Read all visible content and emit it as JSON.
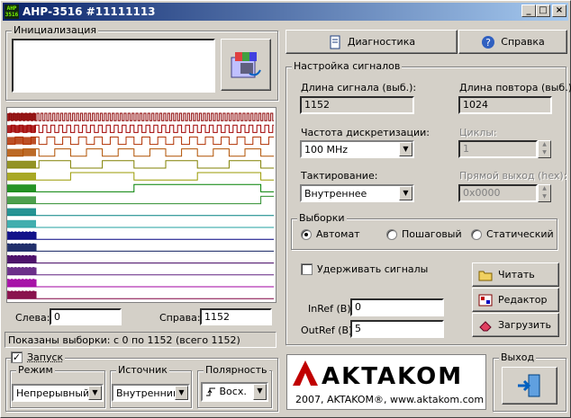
{
  "window": {
    "title": "АНР-3516 #11111113",
    "icon_text": "АНР 3516",
    "minimize": "_",
    "maximize": "□",
    "close": "×"
  },
  "init": {
    "group_label": "Инициализация",
    "text": ""
  },
  "toolbar": {
    "diagnostics_label": "Диагностика",
    "help_label": "Справка"
  },
  "signals": {
    "group_label": "Настройка сигналов",
    "length_label": "Длина сигнала (выб.):",
    "length_value": "1152",
    "repeat_label": "Длина повтора (выб.):",
    "repeat_value": "1024",
    "rate_label": "Частота дискретизации:",
    "rate_value": "100 MHz",
    "cycles_label": "Циклы:",
    "cycles_value": "1",
    "clock_label": "Тактирование:",
    "clock_value": "Внутреннее",
    "direct_label": "Прямой выход (hex):",
    "direct_value": "0x0000"
  },
  "samples": {
    "group_label": "Выборки",
    "auto": "Автомат",
    "step": "Пошаговый",
    "static": "Статический",
    "selected": "auto"
  },
  "hold": {
    "label": "Удерживать сигналы",
    "checked": false
  },
  "refs": {
    "inref_label": "InRef (B)",
    "inref_value": "0",
    "outref_label": "OutRef (B)",
    "outref_value": "5"
  },
  "actions": {
    "read_label": "Читать",
    "editor_label": "Редактор",
    "load_label": "Загрузить"
  },
  "scope": {
    "left_label": "Слева:",
    "left_value": "0",
    "right_label": "Справа:",
    "right_value": "1152"
  },
  "status": "Показаны выборки: с 0 по 1152 (всего 1152)",
  "launch": {
    "label": "Запуск",
    "checked": true,
    "mode_label": "Режим",
    "mode_value": "Непрерывный",
    "source_label": "Источник",
    "source_value": "Внутренний",
    "polarity_label": "Полярность",
    "polarity_value": "Восх."
  },
  "exit": {
    "group_label": "Выход"
  },
  "brand": {
    "name": "AKTAKOM",
    "footer": "2007, AKTAKOM®, www.aktakom.com"
  },
  "chart_data": {
    "type": "line",
    "channels": 16,
    "colors": [
      "#8b0000",
      "#a00000",
      "#b03000",
      "#b05000",
      "#808000",
      "#9a9a00",
      "#008000",
      "#2f8f2f",
      "#008080",
      "#20a0a0",
      "#000080",
      "#102060",
      "#400060",
      "#602080",
      "#a000a0",
      "#800040"
    ]
  }
}
